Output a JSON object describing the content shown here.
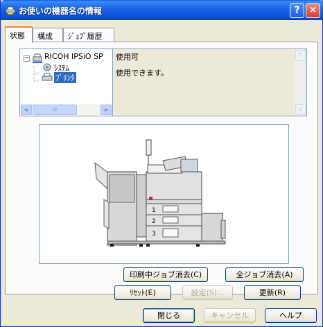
{
  "window": {
    "title": "お使いの機器名の情報"
  },
  "titlebar": {
    "help": "?",
    "close": "✕"
  },
  "tabs": [
    {
      "label": "状態"
    },
    {
      "label": "構成"
    },
    {
      "label": "ｼﾞｮﾌﾞ履歴"
    }
  ],
  "tree": {
    "root": "RICOH IPSiO SP",
    "children": [
      "ｼｽﾃﾑ",
      "ﾌﾟﾘﾝﾀ"
    ],
    "expander": "−",
    "scroll": {
      "left": "<",
      "right": ">",
      "thumb": "III"
    }
  },
  "status": {
    "title": "使用可",
    "message": "使用できます。",
    "scroll": {
      "up": "^",
      "down": "v"
    }
  },
  "printer": {
    "trays": [
      "1",
      "2",
      "3"
    ]
  },
  "buttons": {
    "cancel_current_job": "印刷中ジョブ消去(C)",
    "cancel_all_jobs": "全ジョブ消去(A)",
    "reset": "ﾘｾｯﾄ(E)",
    "settings": "設定(S)...",
    "refresh": "更新(R)",
    "close": "閉じる",
    "cancel": "キャンセル",
    "help": "ヘルプ"
  },
  "colors": {
    "titlebar": "#0b50d8",
    "panel": "#fcfcfe",
    "face": "#ece9d8",
    "selection": "#316ac5"
  }
}
